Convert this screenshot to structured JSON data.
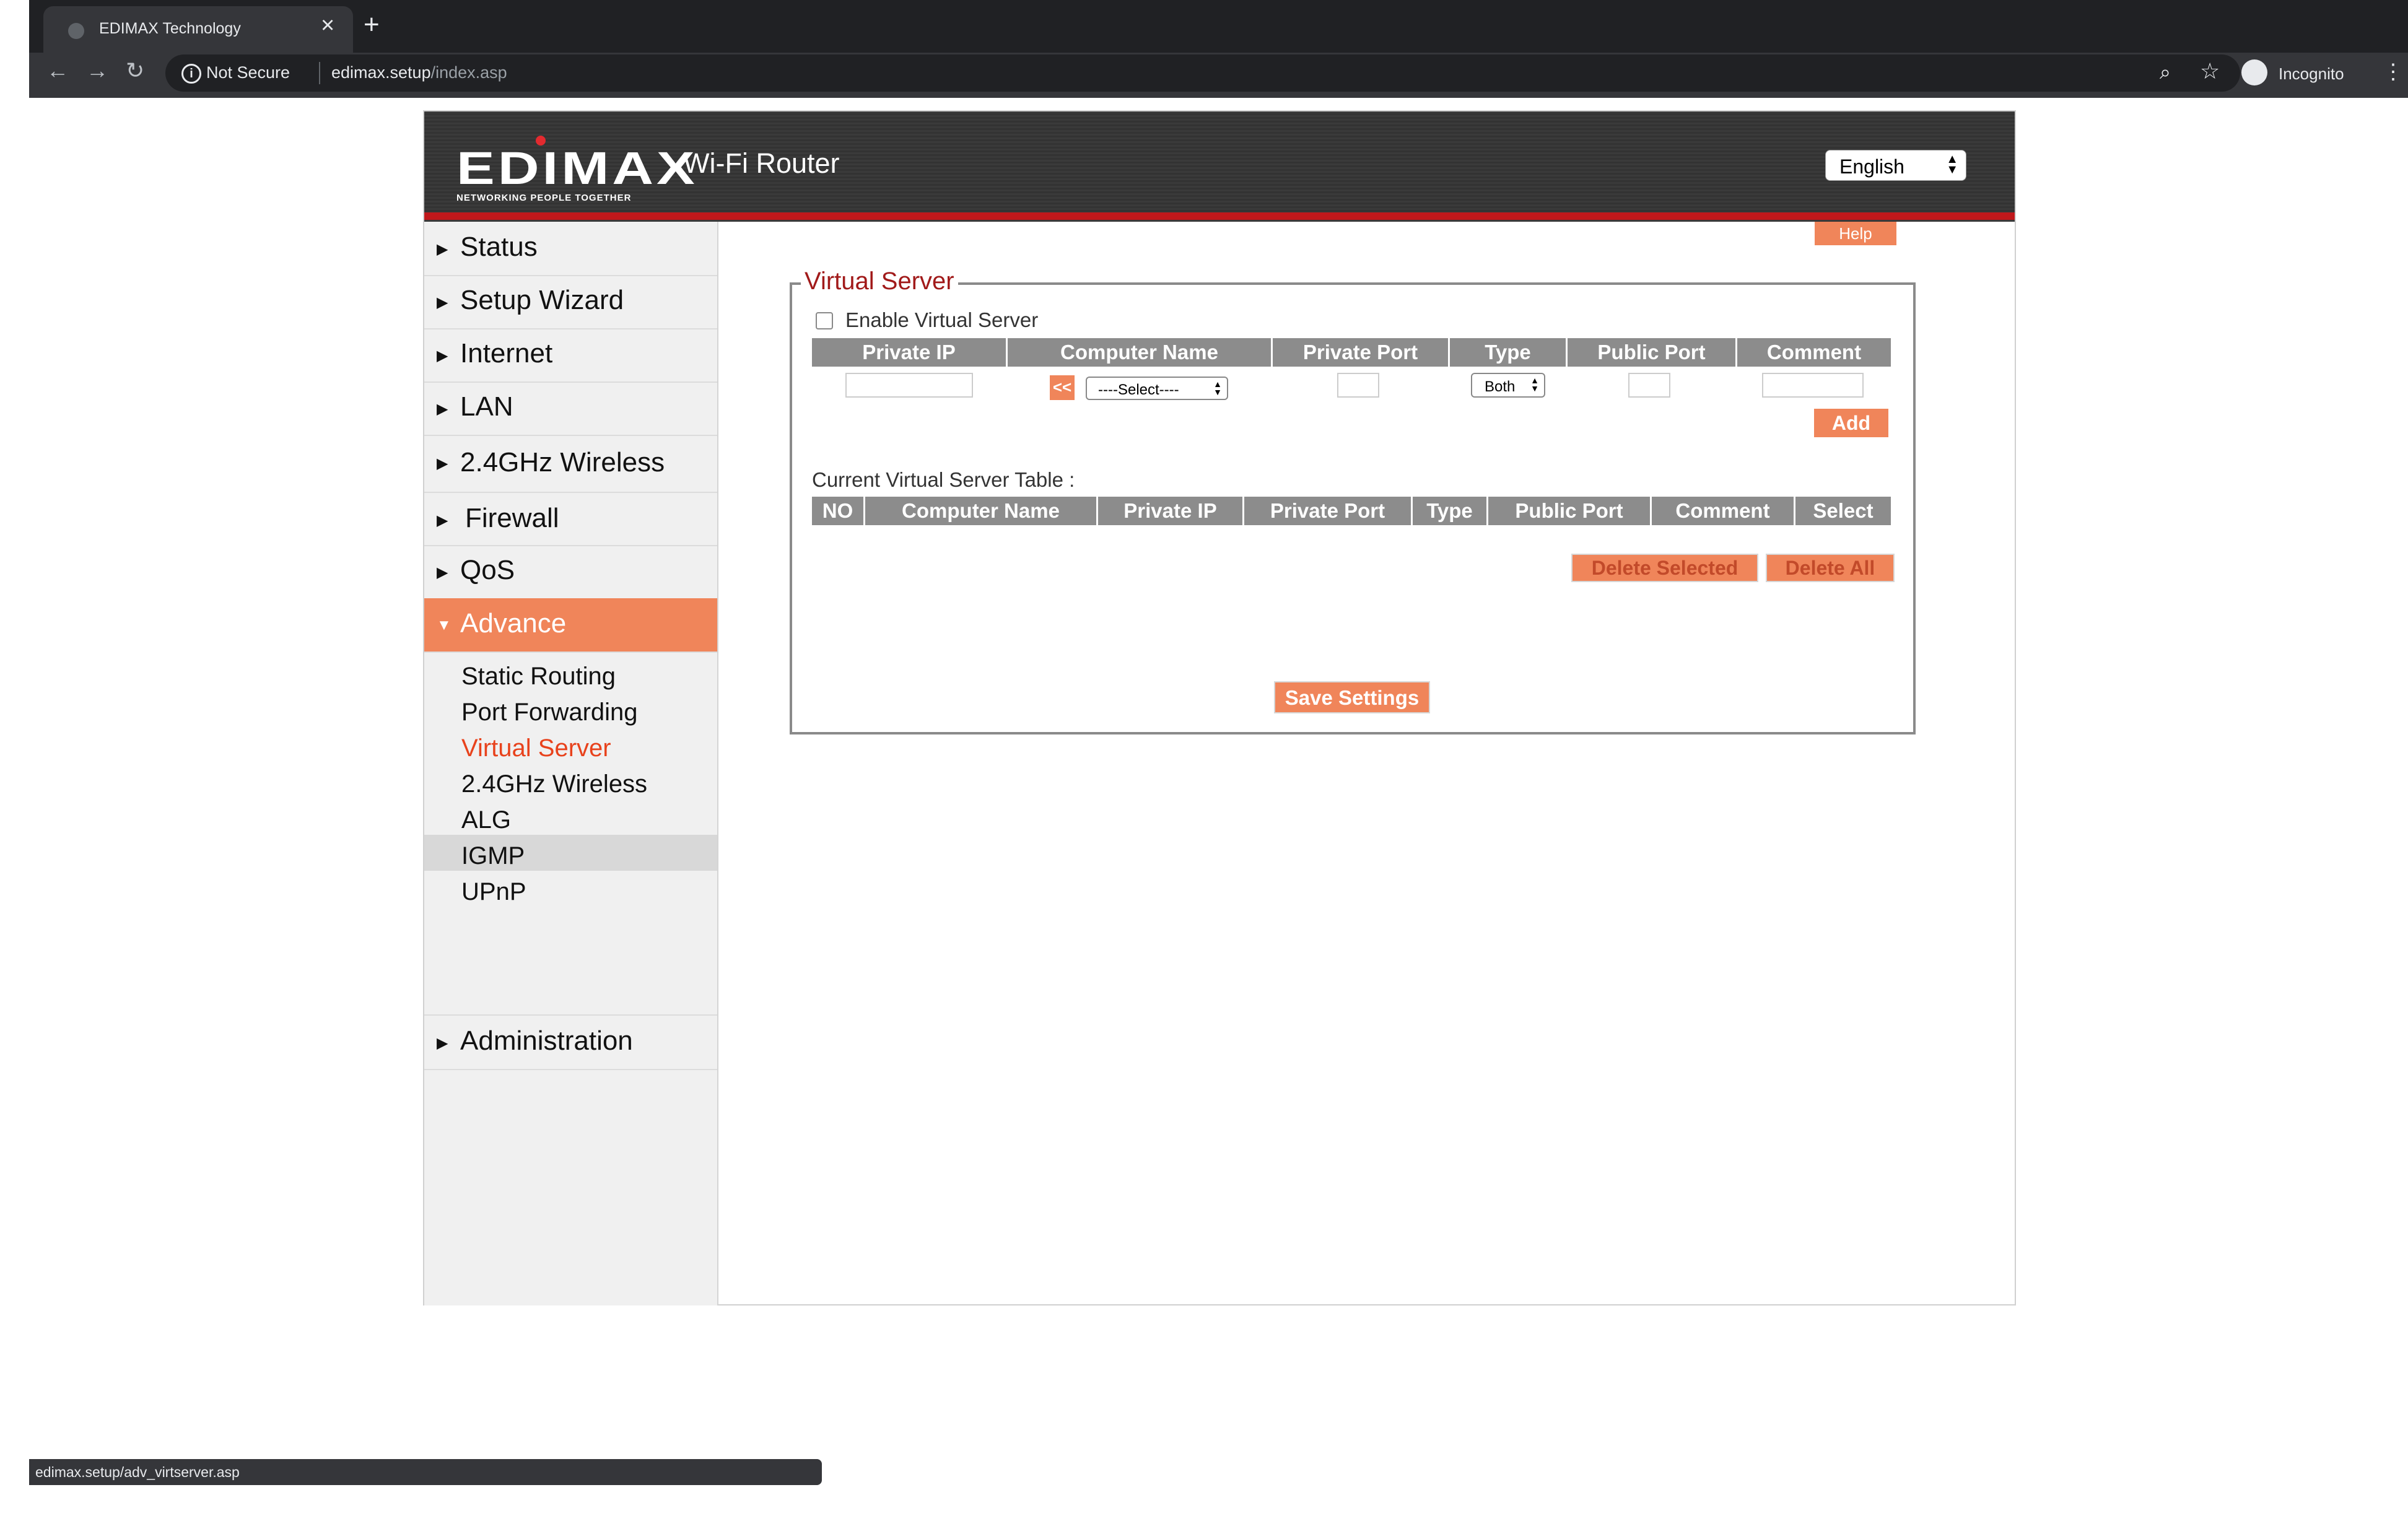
{
  "browser": {
    "tab_title": "EDIMAX Technology",
    "tab_close": "×",
    "new_tab": "+",
    "back": "←",
    "forward": "→",
    "reload": "↻",
    "info_icon": "i",
    "not_secure": "Not Secure",
    "url_host": "edimax.setup",
    "url_path": "/index.asp",
    "zoom_icon": "⌕",
    "star_icon": "☆",
    "profile_label": "Incognito",
    "menu_icon": "⋮",
    "status_url": "edimax.setup/adv_virtserver.asp"
  },
  "header": {
    "logo_text": "EDIMAX",
    "logo_tagline": "NETWORKING PEOPLE TOGETHER",
    "product": "Wi-Fi Router",
    "language": "English",
    "lang_arrow_up": "▲",
    "lang_arrow_down": "▼",
    "colors": {
      "accent": "#f0855a",
      "red_line": "#c0181b",
      "title_red": "#a11a1a"
    }
  },
  "sidebar": {
    "arrow_collapsed": "▶",
    "arrow_expanded": "▼",
    "items": [
      {
        "label": "Status"
      },
      {
        "label": "Setup Wizard"
      },
      {
        "label": "Internet"
      },
      {
        "label": "LAN"
      },
      {
        "label": "2.4GHz Wireless"
      },
      {
        "label": "Firewall"
      },
      {
        "label": "QoS"
      },
      {
        "label": "Advance",
        "active": true
      },
      {
        "label": "Administration"
      }
    ],
    "sub_items": [
      {
        "label": "Static Routing"
      },
      {
        "label": "Port Forwarding"
      },
      {
        "label": "Virtual Server",
        "active": true
      },
      {
        "label": "2.4GHz Wireless"
      },
      {
        "label": "ALG"
      },
      {
        "label": "IGMP"
      },
      {
        "label": "UPnP"
      }
    ]
  },
  "content": {
    "help": "Help",
    "section_title": "Virtual Server",
    "enable_label": "Enable  Virtual Server",
    "enable_checked": false,
    "entry_headers": [
      "Private IP",
      "Computer Name",
      "Private Port",
      "Type",
      "Public Port",
      "Comment"
    ],
    "copy_button": "<<",
    "computer_select": "----Select----",
    "type_select": "Both",
    "select_arrow_up": "▲",
    "select_arrow_down": "▼",
    "add_button": "Add",
    "table_caption": "Current Virtual Server Table :",
    "table_headers": [
      "NO",
      "Computer Name",
      "Private IP",
      "Private Port",
      "Type",
      "Public Port",
      "Comment",
      "Select"
    ],
    "delete_selected": "Delete Selected",
    "delete_all": "Delete All",
    "save_settings": "Save Settings"
  }
}
